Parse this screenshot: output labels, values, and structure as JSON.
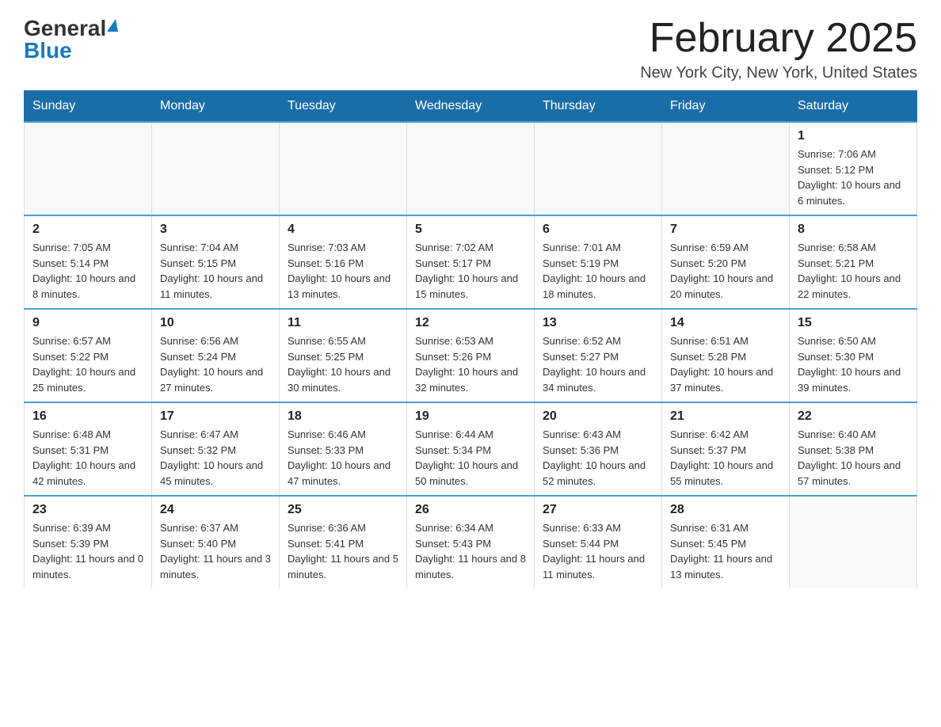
{
  "logo": {
    "general_text": "General",
    "blue_text": "Blue"
  },
  "header": {
    "month_year": "February 2025",
    "location": "New York City, New York, United States"
  },
  "weekdays": [
    "Sunday",
    "Monday",
    "Tuesday",
    "Wednesday",
    "Thursday",
    "Friday",
    "Saturday"
  ],
  "weeks": [
    [
      {
        "day": "",
        "sunrise": "",
        "sunset": "",
        "daylight": ""
      },
      {
        "day": "",
        "sunrise": "",
        "sunset": "",
        "daylight": ""
      },
      {
        "day": "",
        "sunrise": "",
        "sunset": "",
        "daylight": ""
      },
      {
        "day": "",
        "sunrise": "",
        "sunset": "",
        "daylight": ""
      },
      {
        "day": "",
        "sunrise": "",
        "sunset": "",
        "daylight": ""
      },
      {
        "day": "",
        "sunrise": "",
        "sunset": "",
        "daylight": ""
      },
      {
        "day": "1",
        "sunrise": "Sunrise: 7:06 AM",
        "sunset": "Sunset: 5:12 PM",
        "daylight": "Daylight: 10 hours and 6 minutes."
      }
    ],
    [
      {
        "day": "2",
        "sunrise": "Sunrise: 7:05 AM",
        "sunset": "Sunset: 5:14 PM",
        "daylight": "Daylight: 10 hours and 8 minutes."
      },
      {
        "day": "3",
        "sunrise": "Sunrise: 7:04 AM",
        "sunset": "Sunset: 5:15 PM",
        "daylight": "Daylight: 10 hours and 11 minutes."
      },
      {
        "day": "4",
        "sunrise": "Sunrise: 7:03 AM",
        "sunset": "Sunset: 5:16 PM",
        "daylight": "Daylight: 10 hours and 13 minutes."
      },
      {
        "day": "5",
        "sunrise": "Sunrise: 7:02 AM",
        "sunset": "Sunset: 5:17 PM",
        "daylight": "Daylight: 10 hours and 15 minutes."
      },
      {
        "day": "6",
        "sunrise": "Sunrise: 7:01 AM",
        "sunset": "Sunset: 5:19 PM",
        "daylight": "Daylight: 10 hours and 18 minutes."
      },
      {
        "day": "7",
        "sunrise": "Sunrise: 6:59 AM",
        "sunset": "Sunset: 5:20 PM",
        "daylight": "Daylight: 10 hours and 20 minutes."
      },
      {
        "day": "8",
        "sunrise": "Sunrise: 6:58 AM",
        "sunset": "Sunset: 5:21 PM",
        "daylight": "Daylight: 10 hours and 22 minutes."
      }
    ],
    [
      {
        "day": "9",
        "sunrise": "Sunrise: 6:57 AM",
        "sunset": "Sunset: 5:22 PM",
        "daylight": "Daylight: 10 hours and 25 minutes."
      },
      {
        "day": "10",
        "sunrise": "Sunrise: 6:56 AM",
        "sunset": "Sunset: 5:24 PM",
        "daylight": "Daylight: 10 hours and 27 minutes."
      },
      {
        "day": "11",
        "sunrise": "Sunrise: 6:55 AM",
        "sunset": "Sunset: 5:25 PM",
        "daylight": "Daylight: 10 hours and 30 minutes."
      },
      {
        "day": "12",
        "sunrise": "Sunrise: 6:53 AM",
        "sunset": "Sunset: 5:26 PM",
        "daylight": "Daylight: 10 hours and 32 minutes."
      },
      {
        "day": "13",
        "sunrise": "Sunrise: 6:52 AM",
        "sunset": "Sunset: 5:27 PM",
        "daylight": "Daylight: 10 hours and 34 minutes."
      },
      {
        "day": "14",
        "sunrise": "Sunrise: 6:51 AM",
        "sunset": "Sunset: 5:28 PM",
        "daylight": "Daylight: 10 hours and 37 minutes."
      },
      {
        "day": "15",
        "sunrise": "Sunrise: 6:50 AM",
        "sunset": "Sunset: 5:30 PM",
        "daylight": "Daylight: 10 hours and 39 minutes."
      }
    ],
    [
      {
        "day": "16",
        "sunrise": "Sunrise: 6:48 AM",
        "sunset": "Sunset: 5:31 PM",
        "daylight": "Daylight: 10 hours and 42 minutes."
      },
      {
        "day": "17",
        "sunrise": "Sunrise: 6:47 AM",
        "sunset": "Sunset: 5:32 PM",
        "daylight": "Daylight: 10 hours and 45 minutes."
      },
      {
        "day": "18",
        "sunrise": "Sunrise: 6:46 AM",
        "sunset": "Sunset: 5:33 PM",
        "daylight": "Daylight: 10 hours and 47 minutes."
      },
      {
        "day": "19",
        "sunrise": "Sunrise: 6:44 AM",
        "sunset": "Sunset: 5:34 PM",
        "daylight": "Daylight: 10 hours and 50 minutes."
      },
      {
        "day": "20",
        "sunrise": "Sunrise: 6:43 AM",
        "sunset": "Sunset: 5:36 PM",
        "daylight": "Daylight: 10 hours and 52 minutes."
      },
      {
        "day": "21",
        "sunrise": "Sunrise: 6:42 AM",
        "sunset": "Sunset: 5:37 PM",
        "daylight": "Daylight: 10 hours and 55 minutes."
      },
      {
        "day": "22",
        "sunrise": "Sunrise: 6:40 AM",
        "sunset": "Sunset: 5:38 PM",
        "daylight": "Daylight: 10 hours and 57 minutes."
      }
    ],
    [
      {
        "day": "23",
        "sunrise": "Sunrise: 6:39 AM",
        "sunset": "Sunset: 5:39 PM",
        "daylight": "Daylight: 11 hours and 0 minutes."
      },
      {
        "day": "24",
        "sunrise": "Sunrise: 6:37 AM",
        "sunset": "Sunset: 5:40 PM",
        "daylight": "Daylight: 11 hours and 3 minutes."
      },
      {
        "day": "25",
        "sunrise": "Sunrise: 6:36 AM",
        "sunset": "Sunset: 5:41 PM",
        "daylight": "Daylight: 11 hours and 5 minutes."
      },
      {
        "day": "26",
        "sunrise": "Sunrise: 6:34 AM",
        "sunset": "Sunset: 5:43 PM",
        "daylight": "Daylight: 11 hours and 8 minutes."
      },
      {
        "day": "27",
        "sunrise": "Sunrise: 6:33 AM",
        "sunset": "Sunset: 5:44 PM",
        "daylight": "Daylight: 11 hours and 11 minutes."
      },
      {
        "day": "28",
        "sunrise": "Sunrise: 6:31 AM",
        "sunset": "Sunset: 5:45 PM",
        "daylight": "Daylight: 11 hours and 13 minutes."
      },
      {
        "day": "",
        "sunrise": "",
        "sunset": "",
        "daylight": ""
      }
    ]
  ]
}
